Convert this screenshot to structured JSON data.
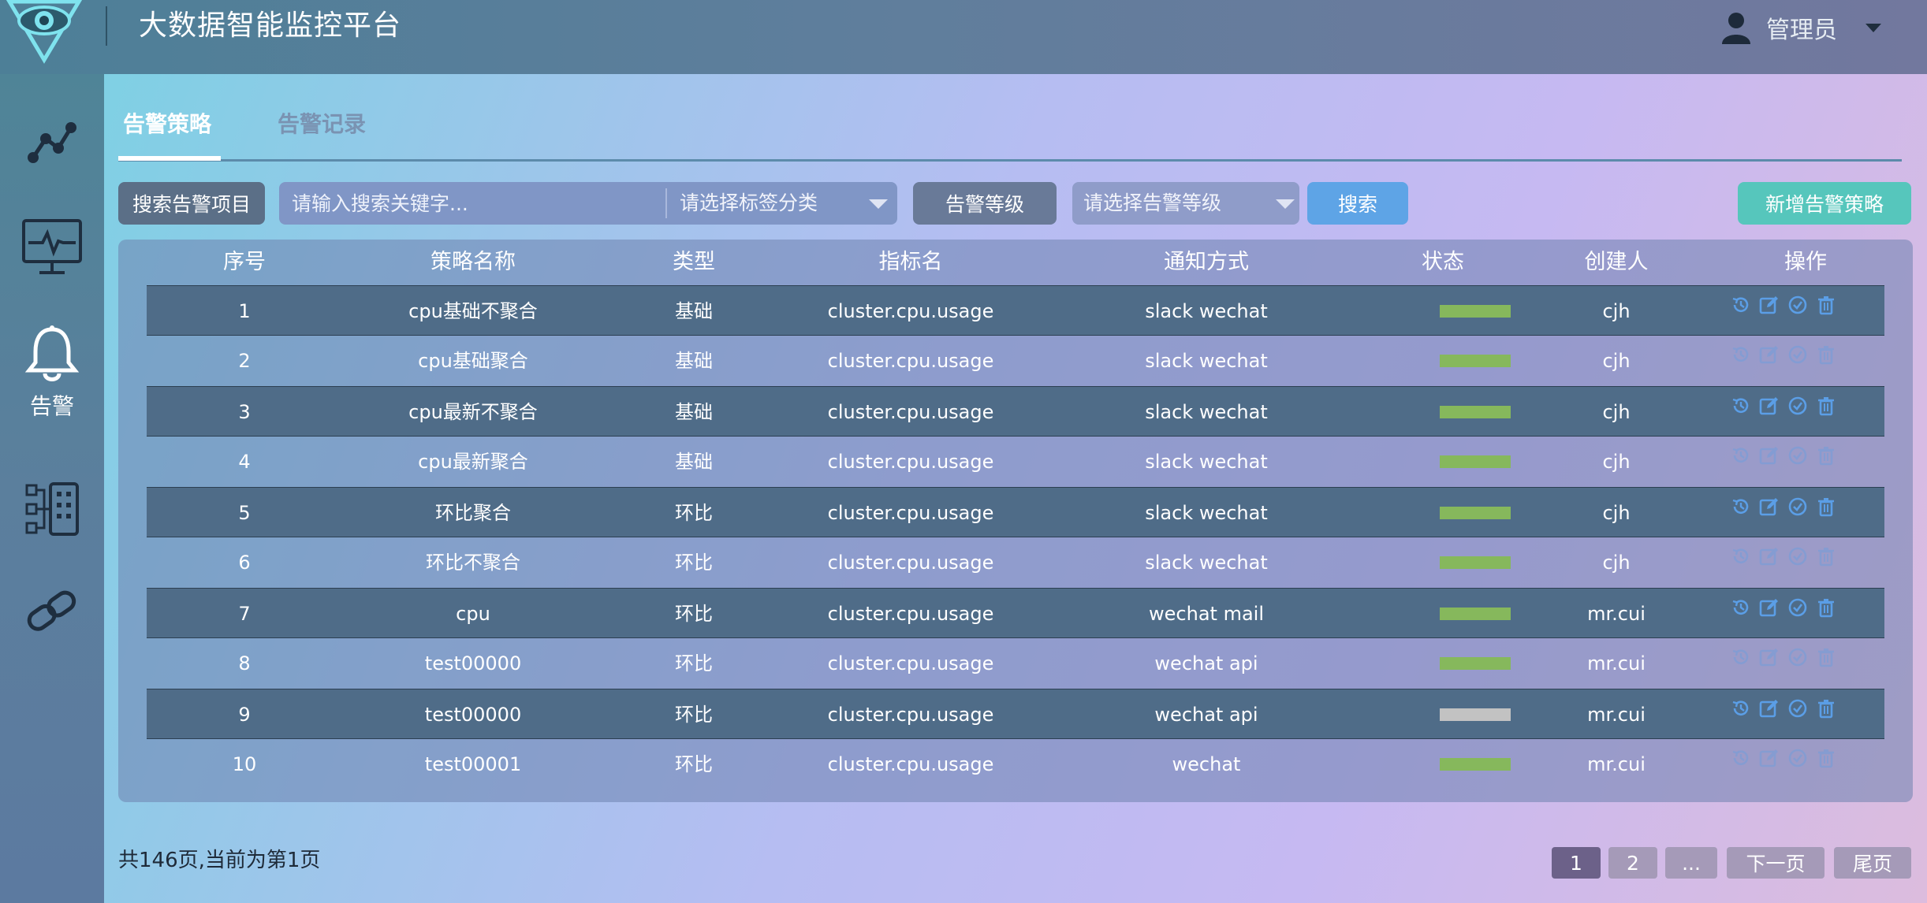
{
  "header": {
    "app_title": "大数据智能监控平台",
    "user_name": "管理员",
    "logo_icon": "eye-triangle-logo",
    "user_icon": "user-icon",
    "caret_icon": "caret-down-icon"
  },
  "sidebar": {
    "items": [
      {
        "name": "graph",
        "icon": "line-graph-icon",
        "label": ""
      },
      {
        "name": "monitor",
        "icon": "monitor-pulse-icon",
        "label": ""
      },
      {
        "name": "alert",
        "icon": "bell-icon",
        "label": "告警",
        "active": true
      },
      {
        "name": "cluster",
        "icon": "cluster-nodes-icon",
        "label": ""
      },
      {
        "name": "link",
        "icon": "link-icon",
        "label": ""
      }
    ]
  },
  "tabs": [
    {
      "label": "告警策略",
      "active": true
    },
    {
      "label": "告警记录",
      "active": false
    }
  ],
  "toolbar": {
    "search_label": "搜索告警项目",
    "search_placeholder": "请输入搜索关键字...",
    "tag_select": "请选择标签分类",
    "level_label": "告警等级",
    "level_select": "请选择告警等级",
    "search_button": "搜索",
    "add_button": "新增告警策略"
  },
  "table": {
    "columns": [
      "序号",
      "策略名称",
      "类型",
      "指标名",
      "通知方式",
      "状态",
      "创建人",
      "操作"
    ],
    "rows": [
      {
        "no": "1",
        "name": "cpu基础不聚合",
        "type": "基础",
        "metric": "cluster.cpu.usage",
        "notify": "slack wechat",
        "status": "on",
        "creator": "cjh"
      },
      {
        "no": "2",
        "name": "cpu基础聚合",
        "type": "基础",
        "metric": "cluster.cpu.usage",
        "notify": "slack wechat",
        "status": "on",
        "creator": "cjh"
      },
      {
        "no": "3",
        "name": "cpu最新不聚合",
        "type": "基础",
        "metric": "cluster.cpu.usage",
        "notify": "slack wechat",
        "status": "on",
        "creator": "cjh"
      },
      {
        "no": "4",
        "name": "cpu最新聚合",
        "type": "基础",
        "metric": "cluster.cpu.usage",
        "notify": "slack wechat",
        "status": "on",
        "creator": "cjh"
      },
      {
        "no": "5",
        "name": "环比聚合",
        "type": "环比",
        "metric": "cluster.cpu.usage",
        "notify": "slack wechat",
        "status": "on",
        "creator": "cjh"
      },
      {
        "no": "6",
        "name": "环比不聚合",
        "type": "环比",
        "metric": "cluster.cpu.usage",
        "notify": "slack wechat",
        "status": "on",
        "creator": "cjh"
      },
      {
        "no": "7",
        "name": "cpu",
        "type": "环比",
        "metric": "cluster.cpu.usage",
        "notify": "wechat mail",
        "status": "on",
        "creator": "mr.cui"
      },
      {
        "no": "8",
        "name": "test00000",
        "type": "环比",
        "metric": "cluster.cpu.usage",
        "notify": "wechat api",
        "status": "on",
        "creator": "mr.cui"
      },
      {
        "no": "9",
        "name": "test00000",
        "type": "环比",
        "metric": "cluster.cpu.usage",
        "notify": "wechat api",
        "status": "off",
        "creator": "mr.cui"
      },
      {
        "no": "10",
        "name": "test00001",
        "type": "环比",
        "metric": "cluster.cpu.usage",
        "notify": "wechat",
        "status": "on",
        "creator": "mr.cui"
      }
    ],
    "row_actions": [
      "history-icon",
      "edit-icon",
      "check-circle-icon",
      "trash-icon"
    ]
  },
  "colors": {
    "status_on": "#86b85c",
    "status_off": "#c2c2c2",
    "action_icon": "#5b9ee6"
  },
  "pagination": {
    "info": "共146页,当前为第1页",
    "pages": [
      "1",
      "2",
      "..."
    ],
    "current": "1",
    "next_label": "下一页",
    "last_label": "尾页"
  }
}
